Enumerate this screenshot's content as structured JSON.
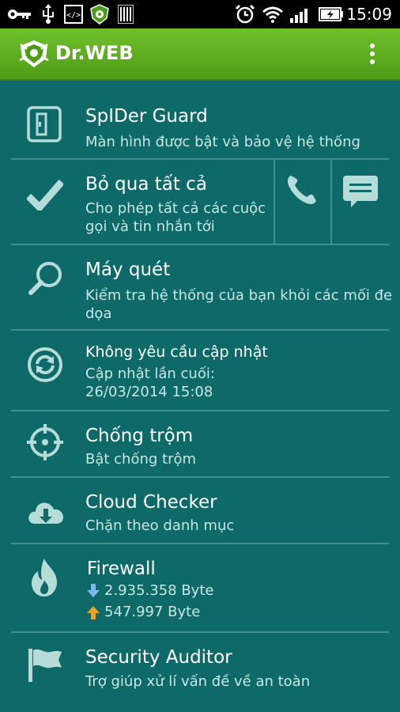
{
  "status_bar": {
    "time": "15:09",
    "icons": [
      "key-icon",
      "usb-icon",
      "code-icon",
      "drweb-icon",
      "barcode-icon",
      "alarm-icon",
      "wifi-icon",
      "signal-icon",
      "battery-icon"
    ]
  },
  "app_bar": {
    "title": "Dr.WEB",
    "menu_icon": "overflow-menu-icon",
    "brand_color": "#5aad1e"
  },
  "colors": {
    "background": "#0e6a68",
    "divider": "#3f8f8d",
    "subtext": "#c7e6e4",
    "download_arrow": "#7db6f0",
    "upload_arrow": "#f0a020"
  },
  "items": {
    "spider_guard": {
      "title": "SpIDer Guard",
      "subtitle": "Màn hình được bật và bảo vệ hệ thống",
      "icon": "shield-door-icon"
    },
    "skip_all": {
      "title": "Bỏ qua tất cả",
      "subtitle_line1": "Cho phép tất cả các cuộc",
      "subtitle_line2": "gọi và tin nhắn tới",
      "icon": "checkmark-icon",
      "call_icon": "phone-icon",
      "message_icon": "message-icon"
    },
    "scanner": {
      "title": "Máy quét",
      "subtitle_line1": "Kiểm tra hệ thống của bạn khỏi các mối đe",
      "subtitle_line2": "dọa",
      "icon": "magnifier-icon"
    },
    "update": {
      "title": "Không yêu cầu cập nhật",
      "subtitle_line1": "Cập nhật lần cuối:",
      "subtitle_line2": "26/03/2014 15:08",
      "icon": "refresh-icon"
    },
    "antitheft": {
      "title": "Chống trộm",
      "subtitle": "Bật chống trộm",
      "icon": "crosshair-icon"
    },
    "cloud_checker": {
      "title": "Cloud Checker",
      "subtitle": "Chặn theo danh mục",
      "icon": "cloud-icon"
    },
    "firewall": {
      "title": "Firewall",
      "download": "2.935.358 Byte",
      "upload": "547.997 Byte",
      "icon": "flame-icon"
    },
    "security_auditor": {
      "title": "Security Auditor",
      "subtitle": "Trợ giúp xử lí vấn đề về an toàn",
      "icon": "flag-icon"
    }
  }
}
